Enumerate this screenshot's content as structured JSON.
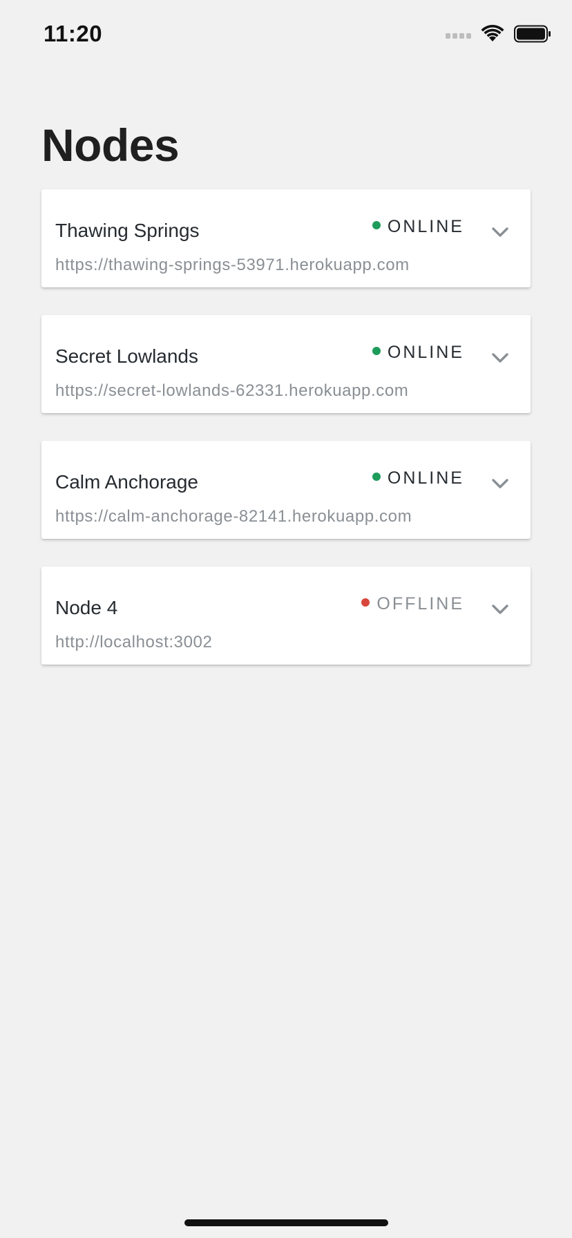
{
  "status_bar": {
    "time": "11:20",
    "icons": [
      "cellular-signal-icon",
      "wifi-icon",
      "battery-icon"
    ]
  },
  "page": {
    "title": "Nodes"
  },
  "colors": {
    "background": "#f1f1f1",
    "card": "#ffffff",
    "online": "#1e9c5a",
    "offline": "#d9463b",
    "online_text": "#262b30",
    "offline_text": "#8a8f94",
    "chevron": "#8a8f94"
  },
  "nodes": [
    {
      "name": "Thawing Springs",
      "url": "https://thawing-springs-53971.herokuapp.com",
      "status": "ONLINE",
      "online": true,
      "action_icon": "chevron-down-icon"
    },
    {
      "name": "Secret Lowlands",
      "url": "https://secret-lowlands-62331.herokuapp.com",
      "status": "ONLINE",
      "online": true,
      "action_icon": "chevron-down-icon"
    },
    {
      "name": "Calm Anchorage",
      "url": "https://calm-anchorage-82141.herokuapp.com",
      "status": "ONLINE",
      "online": true,
      "action_icon": "chevron-down-icon"
    },
    {
      "name": "Node 4",
      "url": "http://localhost:3002",
      "status": "OFFLINE",
      "online": false,
      "action_icon": "chevron-down-icon"
    }
  ]
}
